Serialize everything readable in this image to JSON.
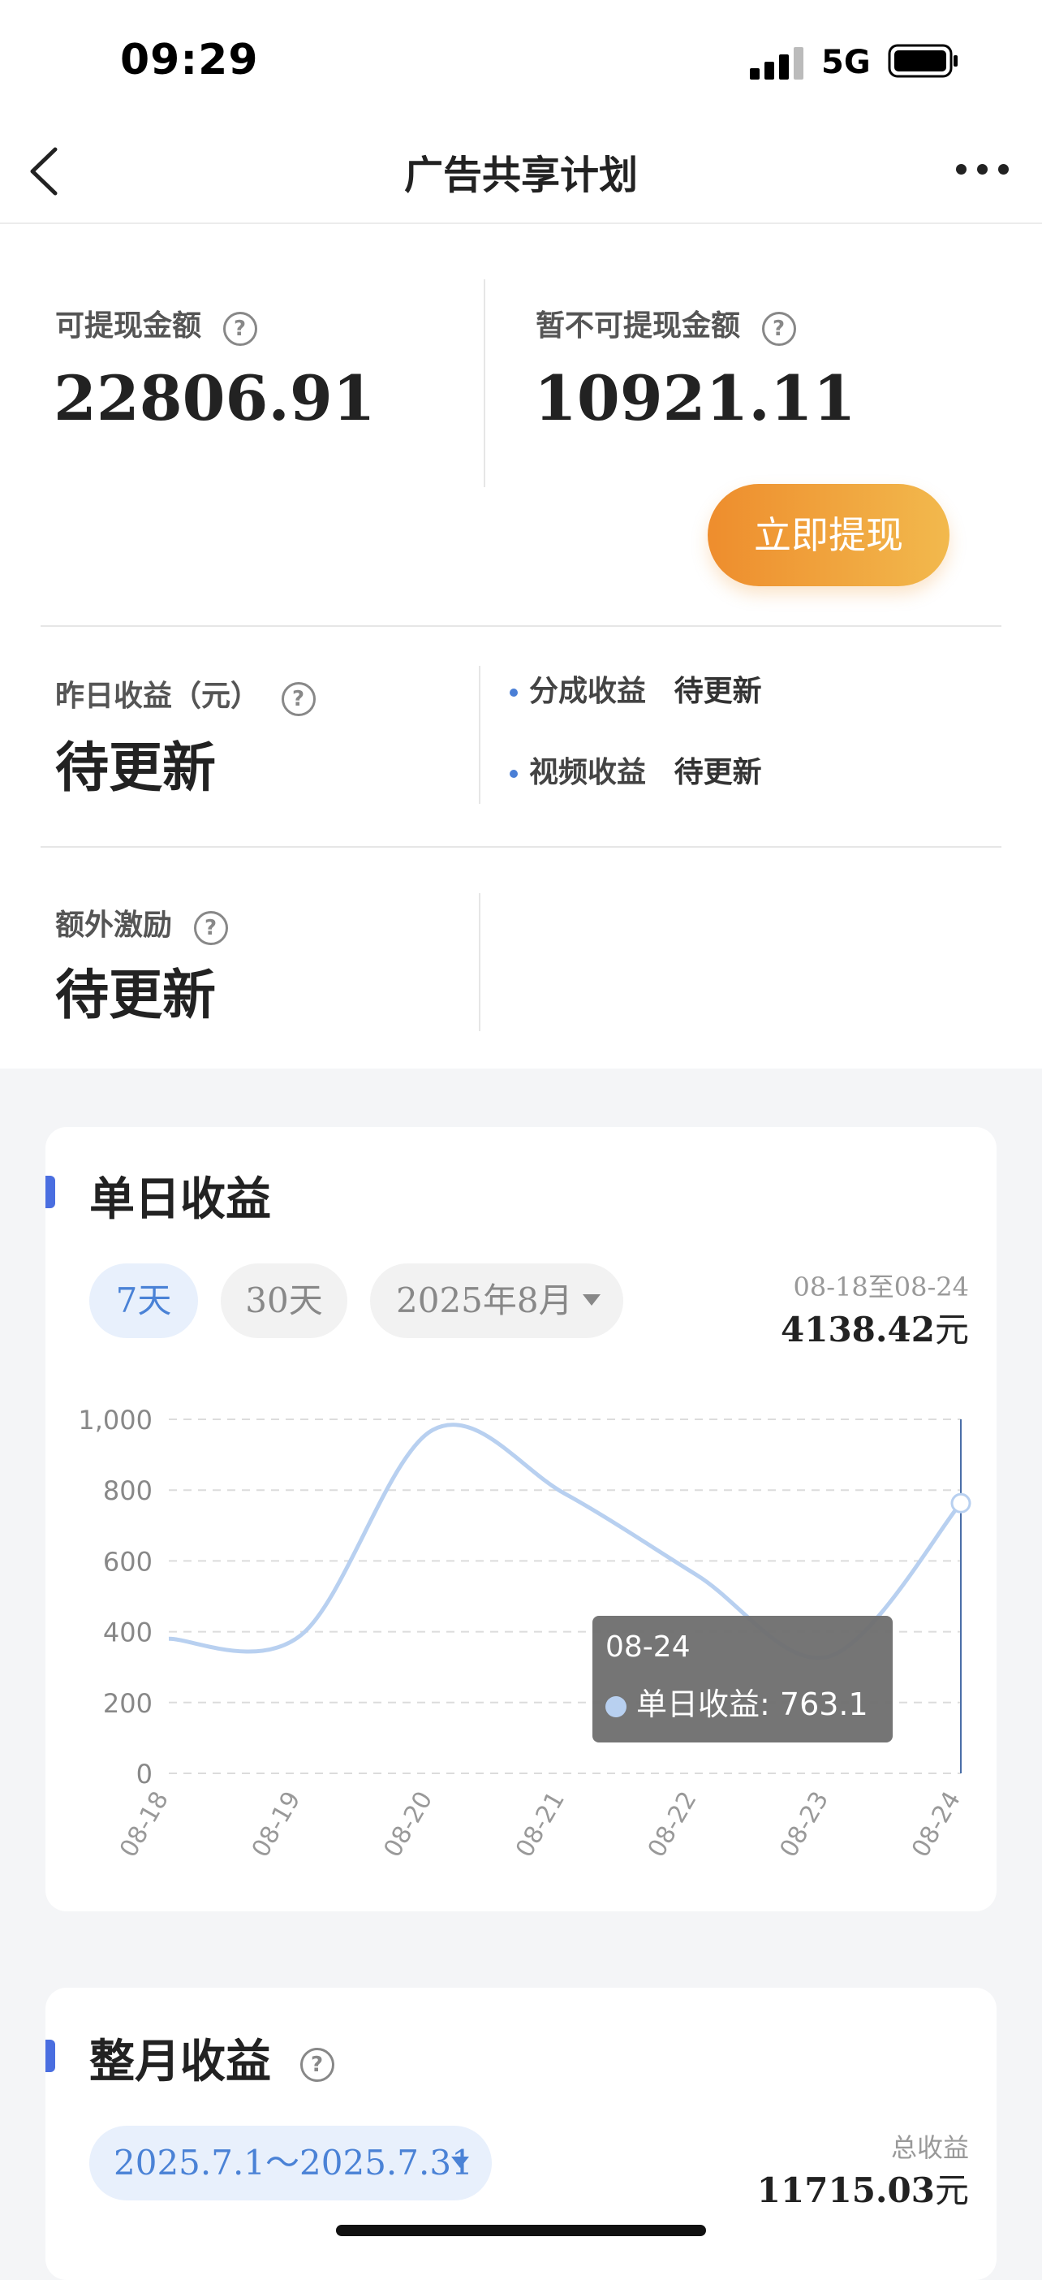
{
  "status_bar": {
    "time": "09:29",
    "network": "5G"
  },
  "nav": {
    "title": "广告共享计划"
  },
  "balance": {
    "withdrawable_label": "可提现金额",
    "withdrawable_value": "22806.91",
    "pending_label": "暂不可提现金额",
    "pending_value": "10921.11",
    "withdraw_button": "立即提现"
  },
  "yesterday": {
    "label": "昨日收益（元）",
    "value": "待更新",
    "items": [
      {
        "label": "分成收益",
        "value": "待更新"
      },
      {
        "label": "视频收益",
        "value": "待更新"
      }
    ]
  },
  "extra": {
    "label": "额外激励",
    "value": "待更新"
  },
  "help_icon_glyph": "?",
  "daily": {
    "title": "单日收益",
    "tabs": [
      "7天",
      "30天",
      "2025年8月"
    ],
    "active_tab": 0,
    "range": "08-18至08-24",
    "total": "4138.42",
    "currency": "元",
    "tooltip": {
      "date": "08-24",
      "series_label": "单日收益",
      "value": "763.1"
    }
  },
  "monthly": {
    "title": "整月收益",
    "date_range": "2025.7.1～2025.7.31",
    "total_label": "总收益",
    "total": "11715.03",
    "currency": "元"
  },
  "colors": {
    "accent": "#4a6ee0",
    "line": "#b8d0f0",
    "button_start": "#ee8d2d",
    "button_end": "#f2b94d"
  },
  "chart_data": {
    "type": "line",
    "categories": [
      "08-18",
      "08-19",
      "08-20",
      "08-21",
      "08-22",
      "08-23",
      "08-24"
    ],
    "series": [
      {
        "name": "单日收益",
        "values": [
          380,
          390,
          970,
          790,
          560,
          330,
          763.1
        ]
      }
    ],
    "ylim": [
      0,
      1000
    ],
    "yticks": [
      "0",
      "200",
      "400",
      "600",
      "800",
      "1,000"
    ],
    "grid": true,
    "highlight_index": 6
  }
}
